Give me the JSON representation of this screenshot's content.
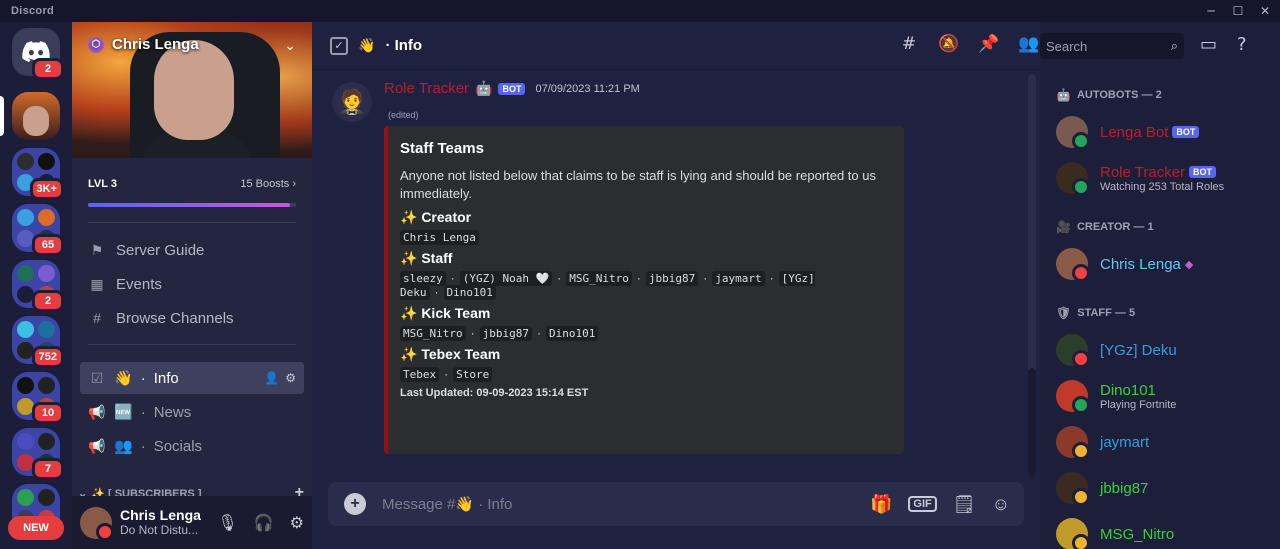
{
  "app": {
    "title": "Discord"
  },
  "rail": {
    "badges": [
      "2",
      "3K+",
      "65",
      "2",
      "752",
      "10",
      "7"
    ],
    "new_label": "NEW"
  },
  "server": {
    "name": "Chris Lenga",
    "level": "LVL 3",
    "boosts": "15 Boosts",
    "boost_progress": 0.97,
    "nav": [
      "Server Guide",
      "Events",
      "Browse Channels"
    ]
  },
  "channels": [
    {
      "emoji": "👋",
      "name": "Info"
    },
    {
      "emoji": "🆕",
      "name": "News"
    },
    {
      "emoji": "👥",
      "name": "Socials"
    }
  ],
  "category": {
    "label": "✨ [ SUBSCRIBERS ]"
  },
  "user": {
    "name": "Chris Lenga",
    "status": "Do Not Distu..."
  },
  "header": {
    "emoji": "👋",
    "title": "· Info",
    "search_placeholder": "Search"
  },
  "message": {
    "author": "Role Tracker",
    "author_emoji": "🤖",
    "bot_tag": "BOT",
    "timestamp": "07/09/2023 11:21 PM",
    "edited": "(edited)",
    "embed": {
      "title": "Staff Teams",
      "description": "Anyone not listed below that claims to be staff is lying and should be reported to us immediately.",
      "fields": [
        {
          "name": "✨ Creator",
          "values": [
            "Chris Lenga"
          ]
        },
        {
          "name": "✨ Staff",
          "values": [
            "sleezy",
            "(YGZ) Noah 🤍",
            "MSG_Nitro",
            "jbbig87",
            "jaymart",
            "[YGz] Deku",
            "Dino101"
          ]
        },
        {
          "name": "✨ Kick Team",
          "values": [
            "MSG_Nitro",
            "jbbig87",
            "Dino101"
          ]
        },
        {
          "name": "✨ Tebex Team",
          "values": [
            "Tebex",
            "Store"
          ]
        }
      ],
      "footer": "Last Updated: 09-09-2023 15:14 EST"
    }
  },
  "composer": {
    "placeholder": "Message #👋 · Info",
    "gif": "GIF"
  },
  "members": {
    "groups": [
      {
        "title": "AUTOBOTS — 2",
        "members": [
          {
            "name": "Lenga Bot",
            "bot": "BOT",
            "activity": "",
            "color": "#b5222a"
          },
          {
            "name": "Role Tracker",
            "bot": "BOT",
            "activity": "Watching 253 Total Roles",
            "color": "#b5222a"
          }
        ]
      },
      {
        "title": "CREATOR — 1",
        "members": [
          {
            "name": "Chris Lenga",
            "bot": "",
            "activity": "",
            "color": "#65c6f0"
          }
        ]
      },
      {
        "title": "STAFF — 5",
        "members": [
          {
            "name": "[YGz] Deku",
            "bot": "",
            "activity": "",
            "color": "#3a9be0"
          },
          {
            "name": "Dino101",
            "bot": "",
            "activity": "Playing Fortnite",
            "color": "#3ad13a"
          },
          {
            "name": "jaymart",
            "bot": "",
            "activity": "",
            "color": "#3a9be0"
          },
          {
            "name": "jbbig87",
            "bot": "",
            "activity": "",
            "color": "#3ad13a"
          },
          {
            "name": "MSG_Nitro",
            "bot": "",
            "activity": "",
            "color": "#3ad13a"
          }
        ]
      }
    ]
  },
  "colors": {
    "accent": "#5865f2",
    "dnd": "#f23f43",
    "online": "#23a55a",
    "idle": "#f0b232",
    "embed_border": "#9b0f12"
  }
}
